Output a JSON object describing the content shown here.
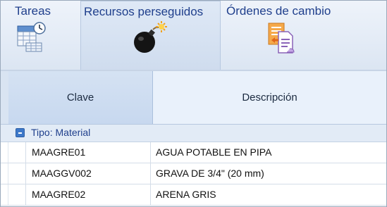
{
  "ribbon": {
    "tabs": [
      {
        "label": "Tareas",
        "icon": "tasks-calendar-clock-icon"
      },
      {
        "label": "Recursos perseguidos",
        "icon": "bomb-icon"
      },
      {
        "label": "Órdenes de cambio",
        "icon": "change-order-document-icon"
      }
    ],
    "selected_tab": "Recursos perseguidos"
  },
  "grid": {
    "columns": [
      "Clave",
      "Descripción"
    ],
    "group": {
      "label": "Tipo: Material",
      "expanded": true
    },
    "rows": [
      {
        "clave": "MAAGRE01",
        "descripcion": "AGUA POTABLE EN PIPA"
      },
      {
        "clave": "MAAGGV002",
        "descripcion": "GRAVA DE 3/4\" (20 mm)"
      },
      {
        "clave": "MAAGRE02",
        "descripcion": "ARENA GRIS"
      }
    ]
  },
  "colors": {
    "ribbon_text": "#1f3f8c",
    "header_bg": "#e9f1fb",
    "accent": "#3d78c9"
  }
}
